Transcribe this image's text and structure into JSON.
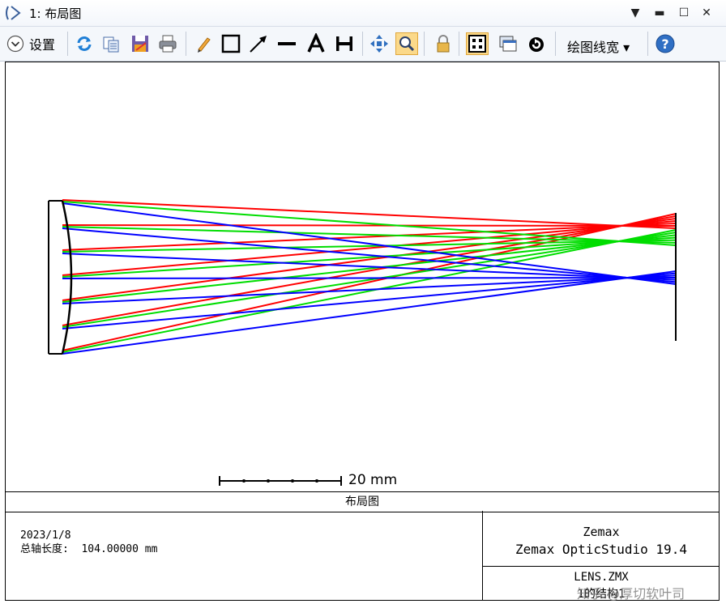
{
  "window": {
    "title": "1: 布局图"
  },
  "toolbar": {
    "settings_label": "设置",
    "plot_linewidth_label": "绘图线宽 ▾"
  },
  "plot": {
    "scale_bar_label": "20 mm",
    "caption": "布局图",
    "date": "2023/1/8",
    "axis_length_label": "总轴长度:",
    "axis_length_value": "104.00000 mm",
    "company": "Zemax",
    "product": "Zemax OpticStudio 19.4",
    "file": "LENS.ZMX",
    "config": "1的结构1"
  },
  "colors": {
    "field1": "#ff0000",
    "field2": "#00dd00",
    "field3": "#0000ff",
    "lens": "#000000",
    "highlight": "#fbd98a"
  },
  "watermark": "知乎 @厚切软叶司"
}
